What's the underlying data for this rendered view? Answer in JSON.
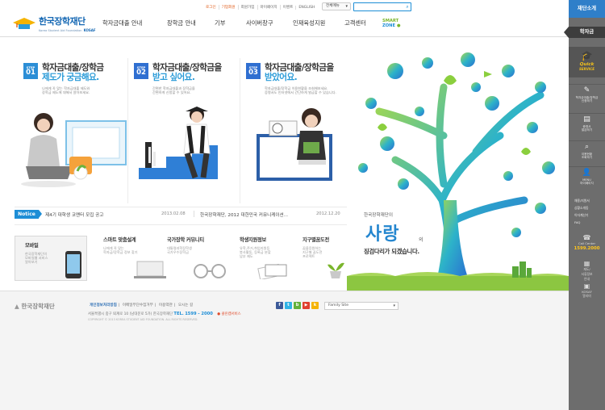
{
  "utility": {
    "items": [
      "로그인",
      "기업회원",
      "회원가입",
      "마이페이지",
      "이벤트",
      "ENGLISH"
    ],
    "site_select": "전체메뉴",
    "search_placeholder": ""
  },
  "logo": {
    "name": "한국장학재단",
    "sub": "Korea Student Aid Foundation",
    "kosaf": "KOSAF"
  },
  "gnb": [
    "학자금대출 안내",
    "장학금 안내",
    "기부",
    "사이버창구",
    "인재육성지원",
    "고객센터"
  ],
  "smart_zone": {
    "line1": "SMART",
    "line2": "ZONE"
  },
  "steps": [
    {
      "step": "STEP",
      "num": "01",
      "title1": "학자금대출/장학금",
      "title2": "제도가 궁금해요.",
      "desc1": "나에게 꼭 맞는 학자금대출 제도와",
      "desc2": "장학금 제도에 대해서 알아보세요."
    },
    {
      "step": "STEP",
      "num": "02",
      "title1": "학자금대출/장학금을",
      "title2": "받고 싶어요.",
      "desc1": "간편한 학자금대출과 장학금을",
      "desc2": "간편하게 신청할 수 있어요."
    },
    {
      "step": "STEP",
      "num": "03",
      "title1": "학자금대출/장학금을",
      "title2": "받았어요.",
      "desc1": "학자금대출/장학금 이용현황을 조회해보세요.",
      "desc2": "증명서도 인터넷에서 간단하게 발급할 수 있습니다."
    }
  ],
  "notice": {
    "badge": "Notice",
    "items": [
      {
        "title": "제4기 대학생 코멘터 모집 공고",
        "date": "2013.02.08"
      },
      {
        "title": "한국장학재단, 2012 대한민국 커뮤니케이션...",
        "date": "2012.12.20"
      }
    ]
  },
  "quick_boxes": [
    {
      "title": "모바일",
      "desc1": "한국장학재단의",
      "desc2": "모바일웹 서비스",
      "desc3": "알아보기"
    },
    {
      "title": "스마트 맞춤설계",
      "desc1": "나에게 꼭 맞는",
      "desc2": "학자금/장학금 정보 찾기",
      "desc3": ""
    },
    {
      "title": "국가장학 커뮤니티",
      "desc1": "대통령과학장학생",
      "desc2": "국가우수장학금",
      "desc3": ""
    },
    {
      "title": "학생지원정보",
      "desc1": "유학,주거,취업지원등",
      "desc2": "봉사활동, 등록금 분할",
      "desc3": "납부 제도"
    },
    {
      "title": "지구별꿈도전",
      "desc1": "꿈을응원하는",
      "desc2": "지구별 꿈도전",
      "desc3": "프로젝트"
    }
  ],
  "tree": {
    "small": "한국장학재단이",
    "big": "사랑",
    "ui": "의",
    "line2": "징검다리가 되겠습니다."
  },
  "right_panel": {
    "top": "재단소개",
    "tab": "학자금",
    "quick1": "Quick",
    "quick2": "SERVICE",
    "items": [
      {
        "l1": "학자금대출/장학금",
        "l2": "신청하기"
      },
      {
        "l1": "증명서",
        "l2": "발급하기"
      },
      {
        "l1": "이용현황",
        "l2": "조회하기"
      },
      {
        "l1": "MENU",
        "l2": "마이페이지"
      }
    ],
    "links": [
      "채용/지원서",
      "상황소개동",
      "이자계산기",
      "FAQ"
    ],
    "call_label": "Call Center",
    "call_num": "1599.2000",
    "more1": "재도/",
    "more2": "서류정보",
    "more3": "안내",
    "kosaf1": "KOSAF",
    "kosaf2": "알리미"
  },
  "footer": {
    "logo": "한국장학재단",
    "links": [
      "개인정보처리방침",
      "이메일무단수집거부",
      "이용약관",
      "오시는 길"
    ],
    "addr": "서울특별시 중구 퇴계로 10 (남대문로 5가) 한국장학재단",
    "tel_label": "TEL.",
    "tel": "1599 - 2000",
    "copy": "COPYRIGHT © 2013 KOREA STUDENT AID FOUNDATION. ALL RIGHTS RESERVED.",
    "family_site": "Family Site",
    "cert": "클린캠서비스"
  },
  "colors": {
    "accent": "#1e8ed6",
    "brand": "#1467b3",
    "green": "#7ab52c",
    "panel": "#6d6d6d"
  }
}
